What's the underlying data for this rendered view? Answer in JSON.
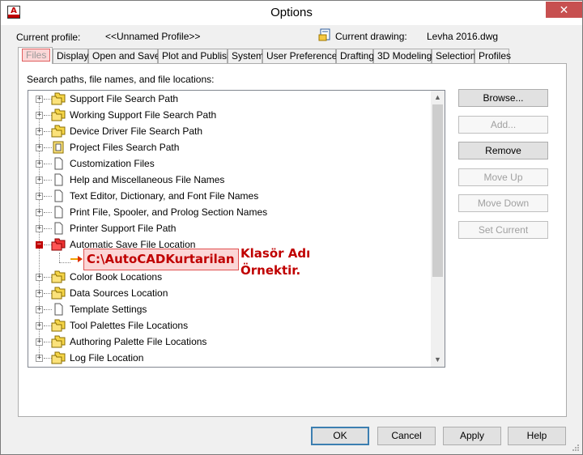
{
  "window": {
    "title": "Options",
    "close_glyph": "✕"
  },
  "profile": {
    "label": "Current profile:",
    "value": "<<Unnamed Profile>>"
  },
  "drawing": {
    "label": "Current drawing:",
    "value": "Levha 2016.dwg"
  },
  "tabs": [
    {
      "label": "Files",
      "active": true
    },
    {
      "label": "Display"
    },
    {
      "label": "Open and Save"
    },
    {
      "label": "Plot and Publish"
    },
    {
      "label": "System"
    },
    {
      "label": "User Preferences"
    },
    {
      "label": "Drafting"
    },
    {
      "label": "3D Modeling"
    },
    {
      "label": "Selection"
    },
    {
      "label": "Profiles"
    }
  ],
  "files": {
    "section_label": "Search paths, file names, and file locations:",
    "tree": [
      {
        "label": "Support File Search Path",
        "icon": "folders-icon"
      },
      {
        "label": "Working Support File Search Path",
        "icon": "folders-icon"
      },
      {
        "label": "Device Driver File Search Path",
        "icon": "folders-icon"
      },
      {
        "label": "Project Files Search Path",
        "icon": "project-files-icon"
      },
      {
        "label": "Customization Files",
        "icon": "document-icon"
      },
      {
        "label": "Help and Miscellaneous File Names",
        "icon": "document-icon"
      },
      {
        "label": "Text Editor, Dictionary, and Font File Names",
        "icon": "document-icon"
      },
      {
        "label": "Print File, Spooler, and Prolog Section Names",
        "icon": "document-icon"
      },
      {
        "label": "Printer Support File Path",
        "icon": "document-icon"
      },
      {
        "label": "Automatic Save File Location",
        "icon": "autosave-folder-icon",
        "expanded": true
      },
      {
        "label": "Color Book Locations",
        "icon": "folders-icon"
      },
      {
        "label": "Data Sources Location",
        "icon": "folders-icon"
      },
      {
        "label": "Template Settings",
        "icon": "document-icon"
      },
      {
        "label": "Tool Palettes File Locations",
        "icon": "folders-icon"
      },
      {
        "label": "Authoring Palette File Locations",
        "icon": "folders-icon"
      },
      {
        "label": "Log File Location",
        "icon": "folders-icon"
      }
    ],
    "autosave_path": "C:\\AutoCADKurtarilan",
    "annotation_line1": "Klasör Adı",
    "annotation_line2": "Örnektir."
  },
  "side_buttons": {
    "browse": "Browse...",
    "add": "Add...",
    "remove": "Remove",
    "move_up": "Move Up",
    "move_down": "Move Down",
    "set_current": "Set Current"
  },
  "bottom_buttons": {
    "ok": "OK",
    "cancel": "Cancel",
    "apply": "Apply",
    "help": "Help"
  },
  "colors": {
    "accent_red": "#c00000",
    "highlight_pink": "#fbd6d6",
    "folder_yellow": "#f5d547"
  }
}
